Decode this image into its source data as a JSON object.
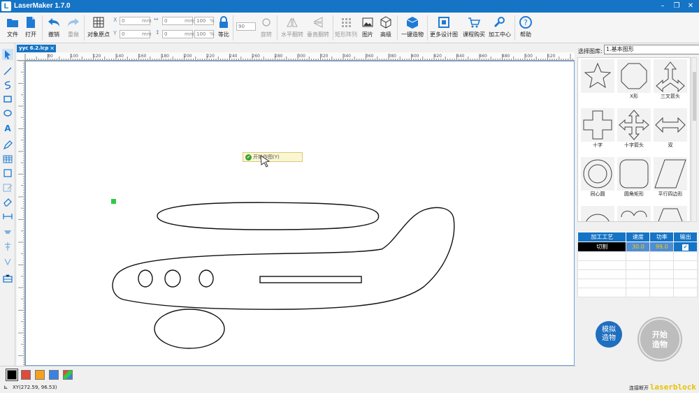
{
  "window": {
    "title": "LaserMaker 1.7.0",
    "logo_letter": "L",
    "minimize": "–",
    "restore": "❐",
    "close": "✕"
  },
  "toolbar": {
    "file": "文件",
    "open": "打开",
    "undo": "撤销",
    "redo": "重做",
    "object_origin": "对象原点",
    "x_value": "0",
    "y_value": "0",
    "w_value": "0",
    "h_value": "0",
    "w_pct": "100",
    "h_pct": "100",
    "unit_mm": "mm",
    "unit_pct": "%",
    "x_label": "X",
    "y_label": "Y",
    "proportional": "等比",
    "rotate_value": "90",
    "rotate": "旋转",
    "flip_h": "水平翻转",
    "flip_v": "垂直翻转",
    "array": "矩形阵列",
    "image": "图片",
    "advanced": "高级",
    "one_click": "一键造物",
    "more_designs": "更多设计图",
    "buy_course": "课程购买",
    "processing_center": "加工中心",
    "help": "帮助"
  },
  "document": {
    "tab_name": "yyc  6.2.lcp",
    "tab_close": "✕",
    "ruler_ticks": [
      "80",
      "100",
      "120",
      "140",
      "160",
      "180",
      "200",
      "220",
      "240",
      "260",
      "280",
      "300",
      "320",
      "340",
      "360",
      "380",
      "400",
      "420",
      "440",
      "460",
      "480",
      "500",
      "520"
    ],
    "context_menu_item": "开始作图(Y)"
  },
  "library": {
    "label": "选择图库:",
    "selected": "1.基本图形",
    "shapes": [
      {
        "name": "star",
        "label": ""
      },
      {
        "name": "octagon-x",
        "label": "X形"
      },
      {
        "name": "three-way-arrow",
        "label": "三叉箭头"
      },
      {
        "name": "cross",
        "label": "十字"
      },
      {
        "name": "cross-arrow",
        "label": "十字箭头"
      },
      {
        "name": "double-arrow",
        "label": "双"
      },
      {
        "name": "concentric-circle",
        "label": "同心圆"
      },
      {
        "name": "rounded-rect",
        "label": "圆角矩形"
      },
      {
        "name": "parallelogram",
        "label": "平行四边形"
      }
    ]
  },
  "process_table": {
    "headers": [
      "加工工艺",
      "速度",
      "功率",
      "输出"
    ],
    "rows": [
      {
        "process": "切割",
        "speed": "30.0",
        "power": "99.0",
        "output": "✔"
      }
    ]
  },
  "actions": {
    "simulate": "模拟造物",
    "start": "开始造物"
  },
  "colors": {
    "accent": "#1574c5",
    "swatches": [
      "#000000",
      "#e04a3b",
      "#f4a21c",
      "#3b82e0",
      "#multi"
    ]
  },
  "status": {
    "coords": "XY(272.59, 96.53)",
    "right_text": "连接断开",
    "watermark": "laserblock"
  }
}
